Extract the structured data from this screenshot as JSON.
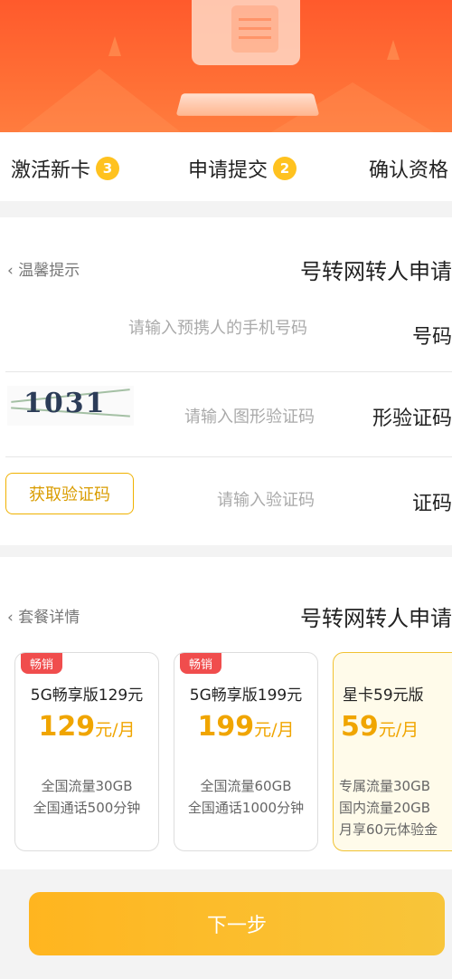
{
  "steps": [
    {
      "num": "3",
      "label": "激活新卡"
    },
    {
      "num": "2",
      "label": "申请提交"
    },
    {
      "label": "确认资格"
    }
  ],
  "form": {
    "title": "号转网转人申请",
    "tip_link": "温馨提示",
    "rows": [
      {
        "label": "号码",
        "placeholder": "请输入预携人的手机号码"
      },
      {
        "label": "形验证码",
        "placeholder": "请输入图形验证码",
        "captcha_text": "1031"
      },
      {
        "label": "证码",
        "placeholder": "请输入验证码",
        "button": "获取验证码"
      }
    ]
  },
  "packages": {
    "title": "号转网转人申请",
    "detail_link": "套餐详情",
    "items": [
      {
        "tag": "畅销",
        "name": "5G畅享版129元",
        "price": "129",
        "unit": "元/月",
        "lines": [
          "全国流量30GB",
          "全国通话500分钟"
        ]
      },
      {
        "tag": "畅销",
        "name": "5G畅享版199元",
        "price": "199",
        "unit": "元/月",
        "lines": [
          "全国流量60GB",
          "全国通话1000分钟"
        ]
      },
      {
        "tag": "",
        "name": "星卡59元版",
        "price": "59",
        "unit": "元/月",
        "lines": [
          "专属流量30GB",
          "国内流量20GB",
          "月享60元体验金"
        ],
        "selected": true
      }
    ]
  },
  "next_button": "下一步",
  "colors": {
    "banner": "#ff6a33",
    "accent": "#ffc21f",
    "price": "#f0a500",
    "tag": "#f04d4d"
  }
}
